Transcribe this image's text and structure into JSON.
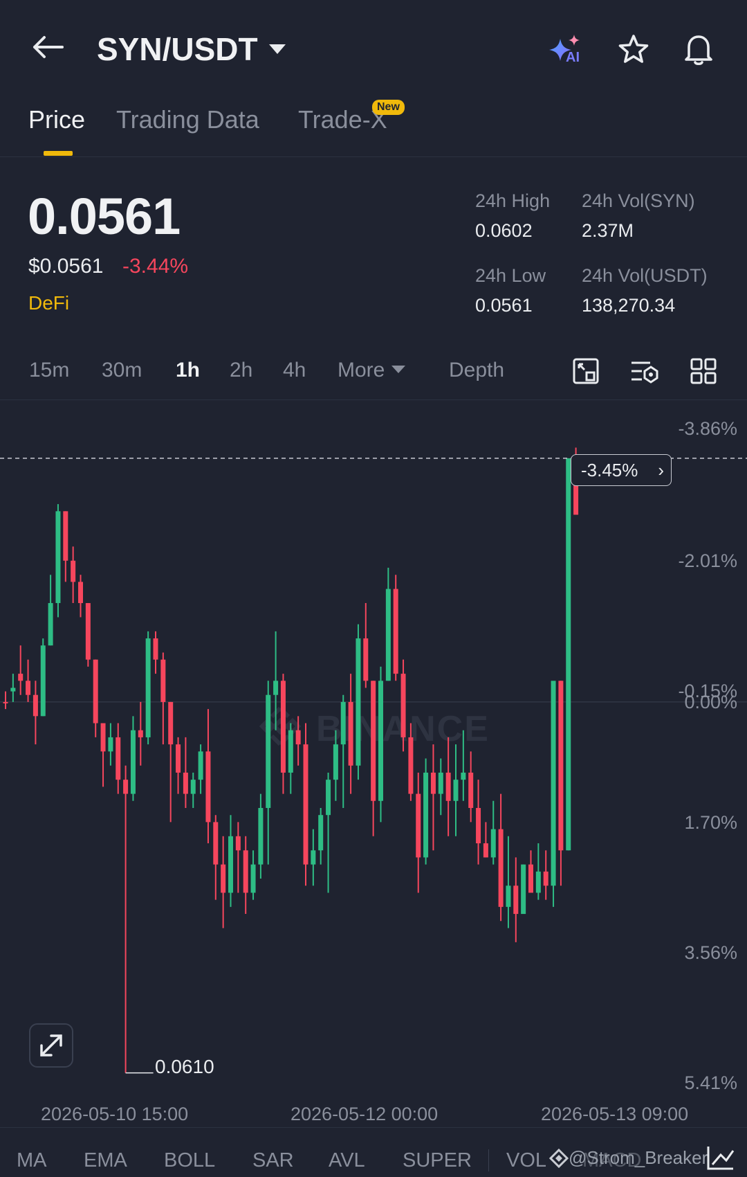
{
  "header": {
    "pair": "SYN/USDT",
    "ai_label": "AI"
  },
  "tabs": [
    {
      "label": "Price",
      "active": true
    },
    {
      "label": "Trading Data",
      "active": false
    },
    {
      "label": "Trade-X",
      "active": false,
      "badge": "New"
    }
  ],
  "ticker": {
    "last_price": "0.0561",
    "usd_price": "$0.0561",
    "change_pct": "-3.44%",
    "tag": "DeFi",
    "high_label": "24h High",
    "high": "0.0602",
    "low_label": "24h Low",
    "low": "0.0561",
    "vol_base_label": "24h Vol(SYN)",
    "vol_base": "2.37M",
    "vol_quote_label": "24h Vol(USDT)",
    "vol_quote": "138,270.34"
  },
  "timeframes": [
    {
      "label": "15m",
      "active": false
    },
    {
      "label": "30m",
      "active": false
    },
    {
      "label": "1h",
      "active": true
    },
    {
      "label": "2h",
      "active": false
    },
    {
      "label": "4h",
      "active": false
    },
    {
      "label": "More",
      "active": false
    },
    {
      "label": "Depth",
      "active": false
    }
  ],
  "chart": {
    "watermark": "BINANCE",
    "current_badge": "-3.45%",
    "low_marker": "0.0610",
    "right_axis": [
      "-3.86%",
      "-2.01%",
      "-0.15%",
      "0.00%",
      "1.70%",
      "3.56%",
      "5.41%"
    ],
    "date_labels": [
      "2026-05-10 15:00",
      "2026-05-12 00:00",
      "2026-05-13 09:00"
    ],
    "colors": {
      "up": "#2ebd85",
      "down": "#f6465d",
      "bg": "#1f2330"
    }
  },
  "indicators": [
    "MA",
    "EMA",
    "BOLL",
    "SAR",
    "AVL",
    "SUPER",
    "VOL",
    "MACD"
  ],
  "footer": {
    "handle": "@Strom_Breaker"
  },
  "chart_data": {
    "type": "candlestick",
    "pair": "SYN/USDT",
    "interval": "1h",
    "yaxis": [
      "-3.86%",
      "-2.01%",
      "-0.15%",
      "0.00%",
      "1.70%",
      "3.56%",
      "5.41%"
    ],
    "yrange_pct": [
      -3.86,
      5.41
    ],
    "xticks": [
      "2026-05-10 15:00",
      "2026-05-12 00:00",
      "2026-05-13 09:00"
    ],
    "candles_pct": [
      [
        0.0,
        -0.15,
        0.1,
        0.0
      ],
      [
        -0.15,
        -0.4,
        0.0,
        -0.2
      ],
      [
        -0.4,
        -0.8,
        -0.1,
        -0.3
      ],
      [
        -0.3,
        -0.6,
        0.0,
        -0.1
      ],
      [
        -0.1,
        -0.3,
        0.6,
        0.2
      ],
      [
        0.2,
        -0.9,
        0.2,
        -0.8
      ],
      [
        -0.8,
        -1.8,
        -0.8,
        -1.4
      ],
      [
        -1.4,
        -2.8,
        -1.2,
        -2.7
      ],
      [
        -2.7,
        -2.7,
        -1.7,
        -2.0
      ],
      [
        -2.0,
        -2.2,
        -1.4,
        -1.7
      ],
      [
        -1.7,
        -1.8,
        -1.2,
        -1.4
      ],
      [
        -1.4,
        -1.4,
        -0.5,
        -0.6
      ],
      [
        -0.6,
        -0.6,
        0.5,
        0.3
      ],
      [
        0.3,
        0.3,
        1.2,
        0.7
      ],
      [
        0.7,
        0.3,
        0.9,
        0.5
      ],
      [
        0.5,
        0.3,
        1.3,
        1.1
      ],
      [
        1.1,
        0.9,
        5.25,
        1.3
      ],
      [
        1.3,
        0.2,
        1.4,
        0.4
      ],
      [
        0.4,
        0.0,
        0.9,
        0.5
      ],
      [
        0.5,
        -1.0,
        0.6,
        -0.9
      ],
      [
        -0.9,
        -1.0,
        -0.4,
        -0.6
      ],
      [
        -0.6,
        -0.7,
        0.6,
        0.0
      ],
      [
        0.0,
        0.0,
        1.7,
        0.6
      ],
      [
        0.6,
        0.5,
        1.3,
        1.0
      ],
      [
        1.0,
        0.5,
        1.5,
        1.3
      ],
      [
        1.3,
        1.0,
        1.5,
        1.1
      ],
      [
        1.1,
        0.6,
        1.3,
        0.7
      ],
      [
        0.7,
        0.1,
        2.0,
        1.7
      ],
      [
        1.7,
        1.6,
        2.8,
        2.3
      ],
      [
        2.3,
        1.9,
        3.2,
        2.7
      ],
      [
        2.7,
        1.6,
        2.9,
        1.9
      ],
      [
        1.9,
        1.7,
        2.7,
        2.1
      ],
      [
        2.1,
        1.9,
        3.0,
        2.7
      ],
      [
        2.7,
        2.1,
        2.8,
        2.3
      ],
      [
        2.3,
        1.3,
        2.5,
        1.5
      ],
      [
        1.5,
        -0.3,
        2.3,
        -0.1
      ],
      [
        -0.1,
        -1.0,
        0.4,
        -0.3
      ],
      [
        -0.3,
        -0.4,
        1.3,
        1.0
      ],
      [
        1.0,
        0.3,
        1.3,
        0.4
      ],
      [
        0.4,
        0.2,
        0.9,
        0.6
      ],
      [
        0.6,
        0.3,
        2.6,
        2.3
      ],
      [
        2.3,
        1.8,
        2.6,
        2.1
      ],
      [
        2.1,
        1.5,
        2.3,
        1.6
      ],
      [
        1.6,
        1.0,
        2.7,
        1.1
      ],
      [
        1.1,
        0.4,
        1.4,
        0.6
      ],
      [
        0.6,
        -0.1,
        1.5,
        0.0
      ],
      [
        0.0,
        -0.4,
        1.3,
        0.9
      ],
      [
        0.9,
        -1.1,
        1.1,
        -0.9
      ],
      [
        -0.9,
        -1.4,
        -0.2,
        -0.3
      ],
      [
        -0.3,
        -0.3,
        1.9,
        1.4
      ],
      [
        1.4,
        -0.5,
        1.7,
        -0.3
      ],
      [
        -0.3,
        -1.9,
        -0.3,
        -1.6
      ],
      [
        -1.6,
        -1.8,
        -0.3,
        -0.4
      ],
      [
        -0.4,
        -0.6,
        0.7,
        0.5
      ],
      [
        0.5,
        0.3,
        1.4,
        1.3
      ],
      [
        1.3,
        1.0,
        2.7,
        2.2
      ],
      [
        2.2,
        0.8,
        2.3,
        1.0
      ],
      [
        1.0,
        0.6,
        2.1,
        1.3
      ],
      [
        1.3,
        0.8,
        1.6,
        1.0
      ],
      [
        1.0,
        0.5,
        1.9,
        1.4
      ],
      [
        1.4,
        0.6,
        1.9,
        1.1
      ],
      [
        1.1,
        0.4,
        1.4,
        1.0
      ],
      [
        1.0,
        0.7,
        1.7,
        1.5
      ],
      [
        1.5,
        1.1,
        2.3,
        2.0
      ],
      [
        2.0,
        1.7,
        2.2,
        2.2
      ],
      [
        2.2,
        1.4,
        2.3,
        1.8
      ],
      [
        1.8,
        1.3,
        3.1,
        2.9
      ],
      [
        2.9,
        1.9,
        3.2,
        2.6
      ],
      [
        2.6,
        2.2,
        3.4,
        3.0
      ],
      [
        3.0,
        2.3,
        3.0,
        2.3
      ],
      [
        2.3,
        2.1,
        2.6,
        2.7
      ],
      [
        2.7,
        2.0,
        2.8,
        2.4
      ],
      [
        2.4,
        2.1,
        2.8,
        2.6
      ],
      [
        2.6,
        -0.1,
        2.9,
        -0.3
      ],
      [
        -0.3,
        -0.3,
        2.6,
        2.1
      ],
      [
        2.1,
        -3.3,
        2.1,
        -3.45
      ],
      [
        -3.45,
        -3.6,
        -2.9,
        -2.65
      ]
    ]
  }
}
